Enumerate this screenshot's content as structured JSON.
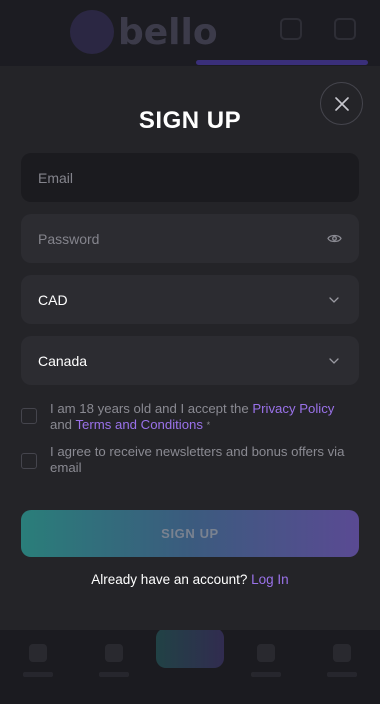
{
  "background": {
    "logo_text": "bello"
  },
  "modal": {
    "title": "SIGN UP",
    "email": {
      "placeholder": "Email",
      "value": ""
    },
    "password": {
      "placeholder": "Password",
      "value": ""
    },
    "currency": {
      "selected": "CAD"
    },
    "country": {
      "selected": "Canada"
    },
    "consent_age": {
      "text_before": "I am 18 years old and I accept the ",
      "privacy_link": "Privacy Policy",
      "text_and": " and ",
      "terms_link": "Terms and Conditions",
      "required_marker": "*",
      "checked": false
    },
    "consent_newsletter": {
      "text": "I agree to receive newsletters and bonus offers via email",
      "checked": false
    },
    "submit_label": "SIGN UP",
    "login_prompt": "Already have an account?",
    "login_link": "Log In"
  },
  "icons": {
    "close": "close-icon",
    "password_toggle": "eye-icon",
    "dropdown": "chevron-down-icon"
  },
  "colors": {
    "accent_link": "#9a72ea",
    "button_gradient_start": "#2a7e7a",
    "button_gradient_end": "#5a4a93",
    "modal_bg": "#242428",
    "field_bg": "#2c2c31"
  }
}
